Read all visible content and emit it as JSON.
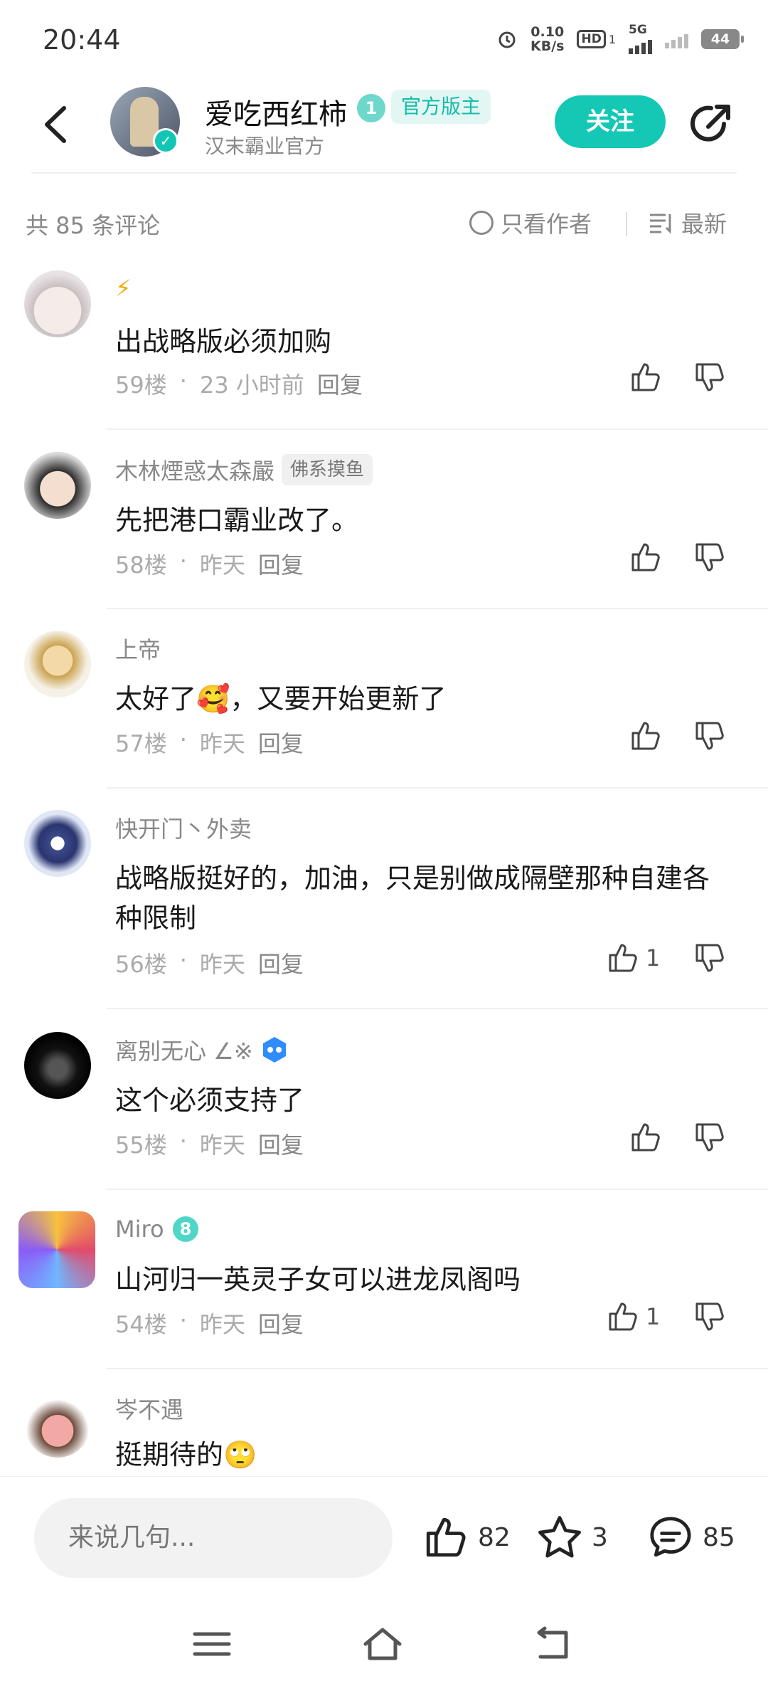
{
  "status_bar": {
    "time": "20:44",
    "net_speed_value": "0.10",
    "net_speed_unit": "KB/s",
    "hd": "HD",
    "hd_sub": "1",
    "network": "5G",
    "battery": "44"
  },
  "header": {
    "author_name": "爱吃西红柿",
    "official_tag": "官方版主",
    "author_sub": "汉末霸业官方",
    "follow_label": "关注",
    "icons": [
      "back-arrow-icon",
      "verified-icon",
      "level-icon",
      "share-icon"
    ]
  },
  "comments_header": {
    "count_label": "共 85 条评论",
    "author_only_label": "只看作者",
    "sort_label": "最新"
  },
  "comments": [
    {
      "name": "⚡",
      "tag": "",
      "text": "出战略版必须加购",
      "floor": "59楼",
      "time": "23 小时前",
      "reply": "回复",
      "likes": ""
    },
    {
      "name": "木林煙惑太森嚴",
      "tag": "佛系摸鱼",
      "text": "先把港口霸业改了。",
      "floor": "58楼",
      "time": "昨天",
      "reply": "回复",
      "likes": ""
    },
    {
      "name": "上帝",
      "tag": "",
      "text": "太好了🥰，又要开始更新了",
      "floor": "57楼",
      "time": "昨天",
      "reply": "回复",
      "likes": ""
    },
    {
      "name": "快开门丶外卖",
      "tag": "",
      "text": "战略版挺好的，加油，只是别做成隔壁那种自建各种限制",
      "floor": "56楼",
      "time": "昨天",
      "reply": "回复",
      "likes": "1"
    },
    {
      "name": "离别无心 ∠※",
      "tag": "",
      "text": "这个必须支持了",
      "floor": "55楼",
      "time": "昨天",
      "reply": "回复",
      "likes": ""
    },
    {
      "name": "Miro",
      "tag": "",
      "text": "山河归一英灵子女可以进龙凤阁吗",
      "floor": "54楼",
      "time": "昨天",
      "reply": "回复",
      "likes": "1"
    },
    {
      "name": "岑不遇",
      "tag": "",
      "text": "挺期待的🙄",
      "floor": "",
      "time": "",
      "reply": "",
      "likes": ""
    }
  ],
  "bottom_bar": {
    "input_placeholder": "来说几句...",
    "likes": "82",
    "favorites": "3",
    "comments": "85"
  },
  "colors": {
    "accent": "#14c8b5",
    "official_tag_bg": "#e2f7f4",
    "muted_text": "#888888"
  }
}
